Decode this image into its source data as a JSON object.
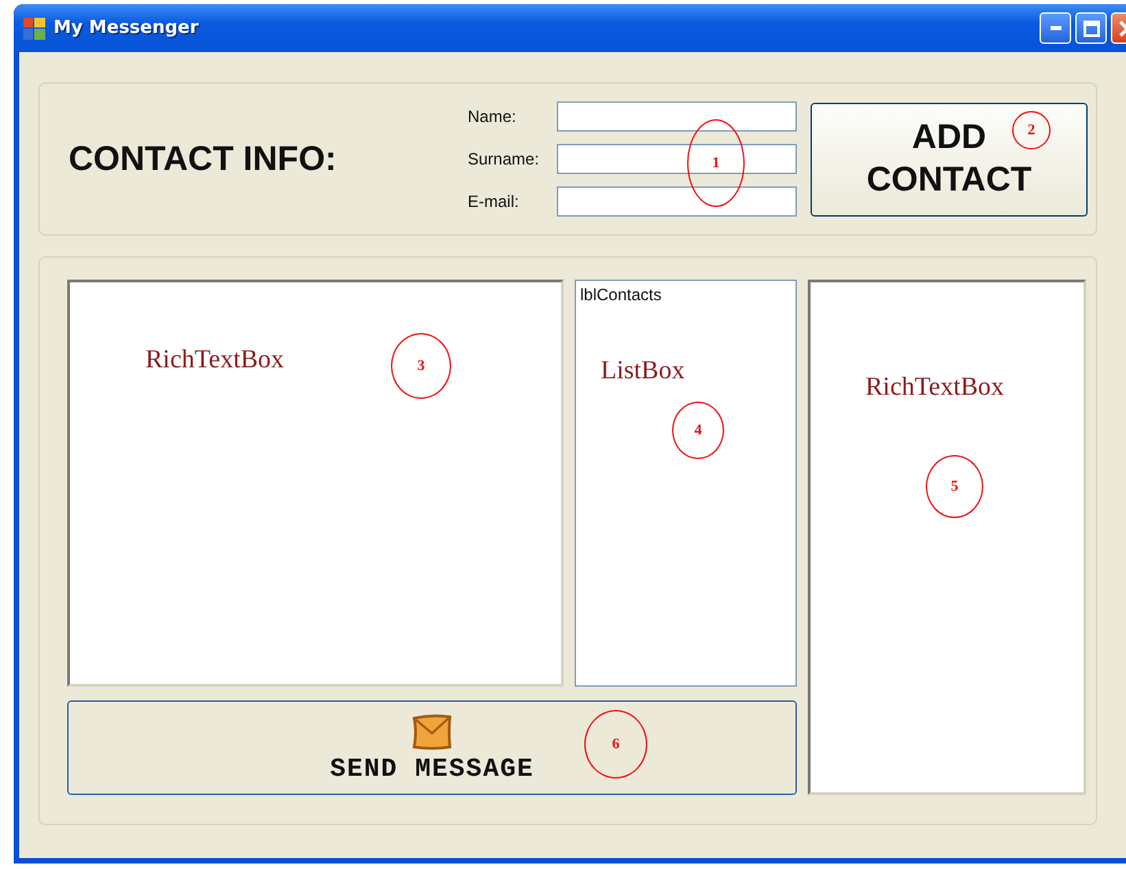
{
  "window": {
    "title": "My Messenger"
  },
  "contact_info": {
    "heading": "CONTACT INFO:",
    "annotation": "1",
    "fields": [
      {
        "label": "Name:"
      },
      {
        "label": "Surname:"
      },
      {
        "label": "E-mail:"
      }
    ],
    "add_button": {
      "label": "ADD CONTACT",
      "annotation": "2"
    }
  },
  "message_pane": {
    "caption": "RichTextBox",
    "annotation": "3"
  },
  "contacts_list": {
    "header": "lblContacts",
    "caption": "ListBox",
    "annotation": "4"
  },
  "chat_pane": {
    "caption": "RichTextBox",
    "annotation": "5"
  },
  "send_button": {
    "label": "SEND MESSAGE",
    "annotation": "6"
  }
}
